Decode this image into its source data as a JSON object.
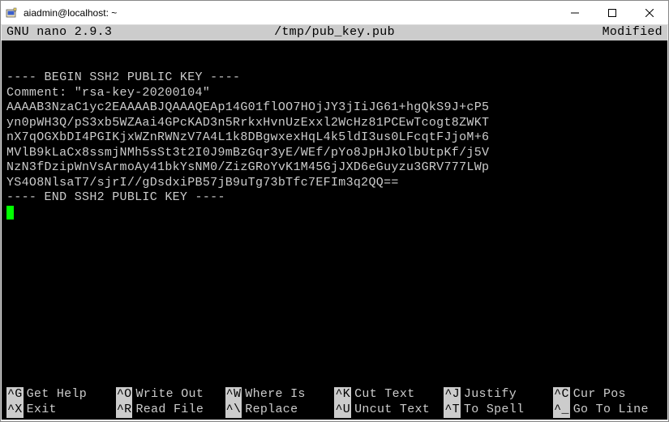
{
  "window": {
    "title": "aiadmin@localhost: ~"
  },
  "nano": {
    "version": "GNU nano 2.9.3",
    "filename": "/tmp/pub_key.pub",
    "status": "Modified"
  },
  "file_content": {
    "lines": [
      "---- BEGIN SSH2 PUBLIC KEY ----",
      "Comment: \"rsa-key-20200104\"",
      "AAAAB3NzaC1yc2EAAAABJQAAAQEAp14G01flOO7HOjJY3jIiJG61+hgQkS9J+cP5",
      "yn0pWH3Q/pS3xb5WZAai4GPcKAD3n5RrkxHvnUzExxl2WcHz81PCEwTcogt8ZWKT",
      "nX7qOGXbDI4PGIKjxWZnRWNzV7A4L1k8DBgwxexHqL4k5ldI3us0LFcqtFJjoM+6",
      "MVlB9kLaCx8ssmjNMh5sSt3t2I0J9mBzGqr3yE/WEf/pYo8JpHJkOlbUtpKf/j5V",
      "NzN3fDzipWnVsArmoAy41bkYsNM0/ZizGRoYvK1M45GjJXD6eGuyzu3GRV777LWp",
      "YS4O8NlsaT7/sjrI//gDsdxiPB57jB9uTg73bTfc7EFIm3q2QQ==",
      "---- END SSH2 PUBLIC KEY ----"
    ]
  },
  "shortcuts": {
    "row1": [
      {
        "key": "^G",
        "label": "Get Help"
      },
      {
        "key": "^O",
        "label": "Write Out"
      },
      {
        "key": "^W",
        "label": "Where Is"
      },
      {
        "key": "^K",
        "label": "Cut Text"
      },
      {
        "key": "^J",
        "label": "Justify"
      },
      {
        "key": "^C",
        "label": "Cur Pos"
      }
    ],
    "row2": [
      {
        "key": "^X",
        "label": "Exit"
      },
      {
        "key": "^R",
        "label": "Read File"
      },
      {
        "key": "^\\",
        "label": "Replace"
      },
      {
        "key": "^U",
        "label": "Uncut Text"
      },
      {
        "key": "^T",
        "label": "To Spell"
      },
      {
        "key": "^_",
        "label": "Go To Line"
      }
    ]
  }
}
